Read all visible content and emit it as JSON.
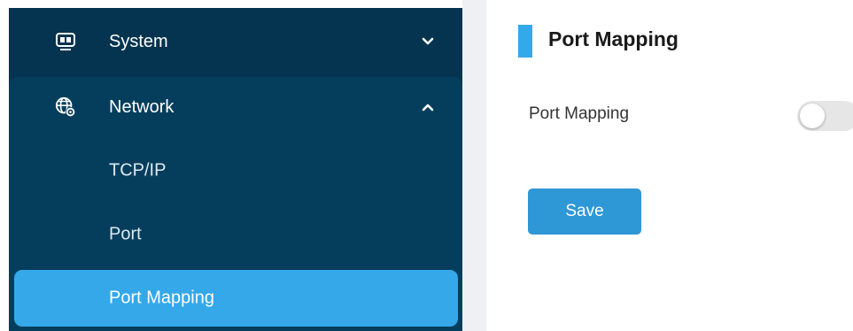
{
  "sidebar": {
    "system": {
      "label": "System",
      "icon": "monitor-icon",
      "expanded": false
    },
    "network": {
      "label": "Network",
      "icon": "network-settings-icon",
      "expanded": true,
      "items": [
        {
          "label": "TCP/IP",
          "active": false
        },
        {
          "label": "Port",
          "active": false
        },
        {
          "label": "Port Mapping",
          "active": true
        }
      ]
    }
  },
  "panel": {
    "title": "Port Mapping",
    "field": {
      "label": "Port Mapping",
      "enabled": false
    },
    "save_label": "Save"
  },
  "colors": {
    "sidebar_bg": "#04344f",
    "group_bg": "#053e5c",
    "accent": "#35a8e9",
    "button": "#2e97d6"
  }
}
